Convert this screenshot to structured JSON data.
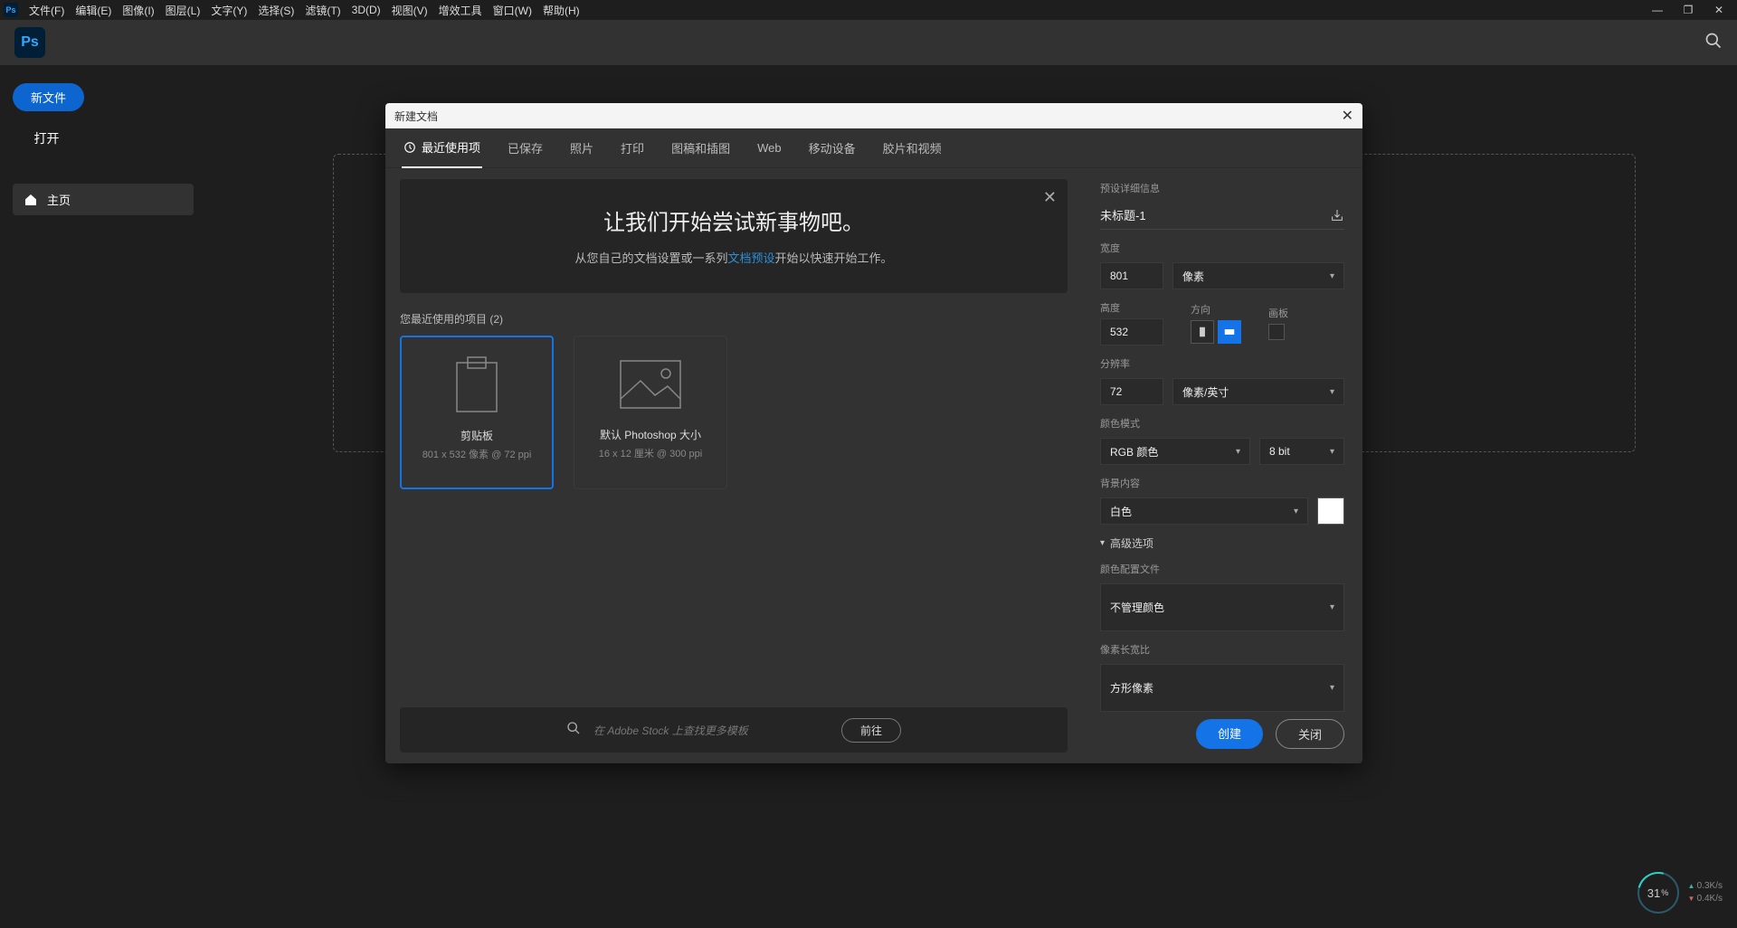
{
  "menubar": {
    "items": [
      "文件(F)",
      "编辑(E)",
      "图像(I)",
      "图层(L)",
      "文字(Y)",
      "选择(S)",
      "滤镜(T)",
      "3D(D)",
      "视图(V)",
      "增效工具",
      "窗口(W)",
      "帮助(H)"
    ]
  },
  "sidebar": {
    "new_file": "新文件",
    "open": "打开",
    "home": "主页"
  },
  "dialog": {
    "title": "新建文档",
    "tabs": [
      "最近使用项",
      "已保存",
      "照片",
      "打印",
      "图稿和插图",
      "Web",
      "移动设备",
      "胶片和视频"
    ],
    "hero_title": "让我们开始尝试新事物吧。",
    "hero_sub_pre": "从您自己的文档设置或一系列",
    "hero_sub_link": "文档预设",
    "hero_sub_post": "开始以快速开始工作。",
    "recent_label": "您最近使用的项目 (2)",
    "presets": [
      {
        "title": "剪贴板",
        "sub": "801 x 532 像素 @ 72 ppi"
      },
      {
        "title": "默认 Photoshop 大小",
        "sub": "16 x 12 厘米 @ 300 ppi"
      }
    ],
    "stock_placeholder": "在 Adobe Stock 上查找更多模板",
    "stock_go": "前往"
  },
  "detail": {
    "section": "预设详细信息",
    "doc_name": "未标题-1",
    "width_label": "宽度",
    "width_value": "801",
    "unit": "像素",
    "height_label": "高度",
    "height_value": "532",
    "orient_label": "方向",
    "artboard_label": "画板",
    "res_label": "分辨率",
    "res_value": "72",
    "res_unit": "像素/英寸",
    "color_mode_label": "颜色模式",
    "color_mode": "RGB 颜色",
    "bit_depth": "8 bit",
    "bg_label": "背景内容",
    "bg_value": "白色",
    "adv": "高级选项",
    "profile_label": "颜色配置文件",
    "profile_value": "不管理颜色",
    "aspect_label": "像素长宽比",
    "aspect_value": "方形像素",
    "create": "创建",
    "close": "关闭"
  },
  "gauge": {
    "pct": "31",
    "unit": "%",
    "up": "0.3K/s",
    "down": "0.4K/s"
  }
}
